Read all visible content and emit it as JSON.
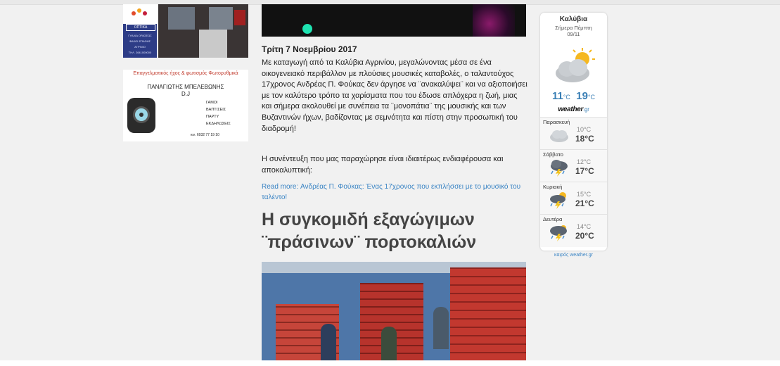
{
  "left_ads": {
    "ad1": {
      "brand": "ΟΠΤΙΚΑ",
      "lines": [
        "ΓΥΑΛΙΑ ΟΡΑΣΕΩΣ",
        "ΦΑΚΟΙ ΕΠΑΦΗΣ",
        "ΑΓΡΙΝΙΟ",
        "ΤΗΛ. 2641000000"
      ]
    },
    "ad2": {
      "title": "Επαγγελματικός ήχος & φωτισμός Φωτορυθμικά",
      "name": "ΠΑΝΑΓΙΩΤΗΣ ΜΠΕΛΕΒΩΝΗΣ",
      "dj": "D.J",
      "services": [
        "ΓΑΜΟΙ",
        "ΒΑΠΤΙΣΕΙΣ",
        "ΠΑΡΤΥ",
        "ΕΚΔΗΛΩΣΕΙΣ"
      ],
      "phone": "κιν. 6932 77 19 10"
    }
  },
  "article": {
    "date": "Τρίτη 7 Νοεμβρίου 2017",
    "paragraph1": "Με καταγωγή από τα Καλύβια Αγρινίου, μεγαλώνοντας μέσα σε ένα οικογενειακό περιβάλλον με πλούσιες μουσικές καταβολές, ο ταλαντούχος 17χρονος Ανδρέας Π. Φούκας δεν άργησε να ¨ανακαλύψει¨ και να αξιοποιήσει με τον καλύτερο τρόπο τα χαρίσματα που του έδωσε απλόχερα η ζωή, μιας και σήμερα ακολουθεί με συνέπεια τα ¨μονοπάτια¨ της μουσικής και των Βυζαντινών ήχων, βαδίζοντας με σεμνότητα και πίστη στην προσωπική του διαδρομή!",
    "paragraph2": "Η συνέντευξη που μας παραχώρησε είναι ιδιαιτέρως ενδιαφέρουσα και αποκαλυπτική:",
    "readmore": "Read more: Ανδρέας Π. Φούκας: Ένας 17χρονος που εκπλήσσει με το μουσικό του ταλέντο!"
  },
  "article2": {
    "heading": "Η συγκομιδή εξαγώγιμων ¨πράσινων¨ πορτοκαλιών"
  },
  "weather": {
    "city": "Καλύβια",
    "today_label": "Σήμερα Πέμπτη",
    "today_date": "09/11",
    "low": "11",
    "high": "19",
    "unit": "°C",
    "logo": "weather",
    "logo_suffix": ".gr",
    "days": [
      {
        "name": "Παρασκευή",
        "low": "10°C",
        "high": "18°C",
        "icon": "cloud-icon"
      },
      {
        "name": "Σάββατο",
        "low": "12°C",
        "high": "17°C",
        "icon": "rain-cloud-icon"
      },
      {
        "name": "Κυριακή",
        "low": "15°C",
        "high": "21°C",
        "icon": "sun-rain-cloud-icon"
      },
      {
        "name": "Δευτέρα",
        "low": "14°C",
        "high": "20°C",
        "icon": "rain-cloud-icon"
      }
    ],
    "footer": "καιρός weather.gr"
  }
}
